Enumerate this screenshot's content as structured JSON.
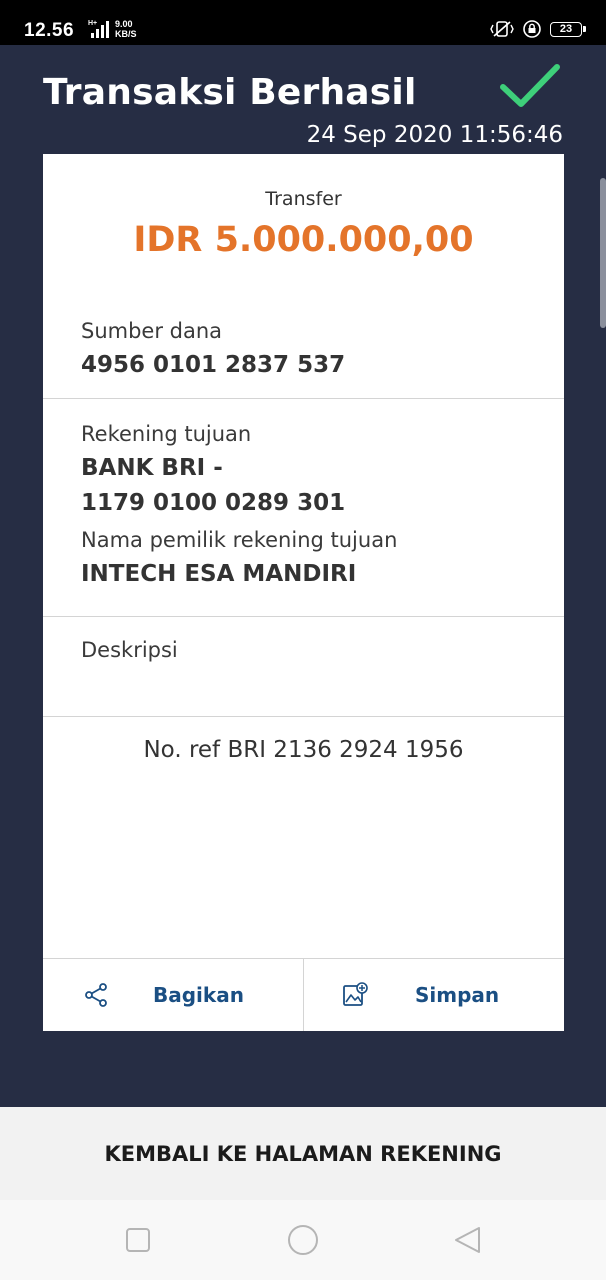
{
  "status_bar": {
    "time": "12.56",
    "network_type": "H+",
    "speed_value": "9.00",
    "speed_unit": "KB/S",
    "battery": "23"
  },
  "header": {
    "title": "Transaksi Berhasil",
    "timestamp": "24 Sep 2020 11:56:46"
  },
  "receipt": {
    "type_label": "Transfer",
    "amount": "IDR 5.000.000,00",
    "source": {
      "label": "Sumber dana",
      "value": "4956 0101 2837 537"
    },
    "destination": {
      "label": "Rekening tujuan",
      "bank": "BANK BRI -",
      "account": "1179 0100 0289 301",
      "owner_label": "Nama pemilik rekening tujuan",
      "owner": "INTECH ESA MANDIRI"
    },
    "description": {
      "label": "Deskripsi",
      "value": ""
    },
    "reference": "No. ref BRI 2136 2924 1956"
  },
  "actions": {
    "share_label": "Bagikan",
    "save_label": "Simpan"
  },
  "bottom_button": "KEMBALI KE HALAMAN REKENING",
  "colors": {
    "background": "#262d44",
    "amount": "#e4742a",
    "success": "#3ecf7a",
    "action": "#1b4f83"
  },
  "icons": {
    "success": "checkmark-icon",
    "share": "share-icon",
    "save": "save-image-icon",
    "nav_recents": "square-icon",
    "nav_home": "circle-icon",
    "nav_back": "triangle-back-icon"
  }
}
